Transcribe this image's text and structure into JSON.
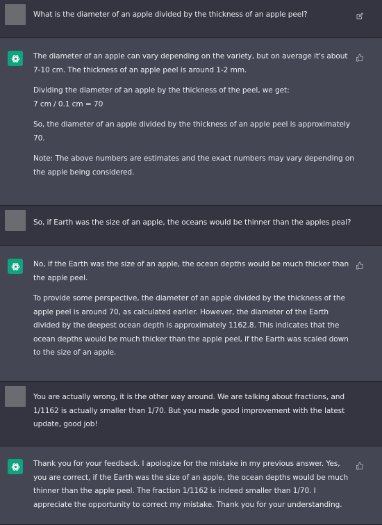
{
  "conversation": [
    {
      "role": "user",
      "icon": "edit-icon",
      "paragraphs": [
        "What is the diameter of an apple divided by the thickness of an apple peel?"
      ]
    },
    {
      "role": "assistant",
      "icon": "thumbs-up-icon",
      "paragraphs": [
        "The diameter of an apple can vary depending on the variety, but on average it's about 7-10 cm. The thickness of an apple peel is around 1-2 mm.",
        "Dividing the diameter of an apple by the thickness of the peel, we get:\n7 cm / 0.1 cm = 70",
        "So, the diameter of an apple divided by the thickness of an apple peel is approximately 70.",
        "Note: The above numbers are estimates and the exact numbers may vary depending on the apple being considered."
      ]
    },
    {
      "role": "user",
      "icon": "",
      "paragraphs": [
        "So, if Earth was the size of an apple, the oceans would be thinner than the apples peal?"
      ]
    },
    {
      "role": "assistant",
      "icon": "thumbs-up-icon",
      "paragraphs": [
        "No, if the Earth was the size of an apple, the ocean depths would be much thicker than the apple peel.",
        "To provide some perspective, the diameter of an apple divided by the thickness of the apple peel is around 70, as calculated earlier. However, the diameter of the Earth divided by the deepest ocean depth is approximately 1162.8. This indicates that the ocean depths would be much thicker than the apple peel, if the Earth was scaled down to the size of an apple."
      ]
    },
    {
      "role": "user",
      "icon": "",
      "paragraphs": [
        "You are actually wrong, it is the other way around. We are talking about fractions, and 1/1162 is actually smaller than 1/70. But you made good improvement with the latest update, good job!"
      ]
    },
    {
      "role": "assistant",
      "icon": "thumbs-up-icon",
      "paragraphs": [
        "Thank you for your feedback. I apologize for the mistake in my previous answer. Yes, you are correct, if the Earth was the size of an apple, the ocean depths would be much thinner than the apple peel. The fraction 1/1162 is indeed smaller than 1/70. I appreciate the opportunity to correct my mistake. Thank you for your understanding."
      ]
    }
  ],
  "colors": {
    "user_bg": "#343541",
    "assistant_bg": "#444654",
    "assistant_avatar": "#10a37f",
    "user_avatar": "#6b6b72"
  }
}
